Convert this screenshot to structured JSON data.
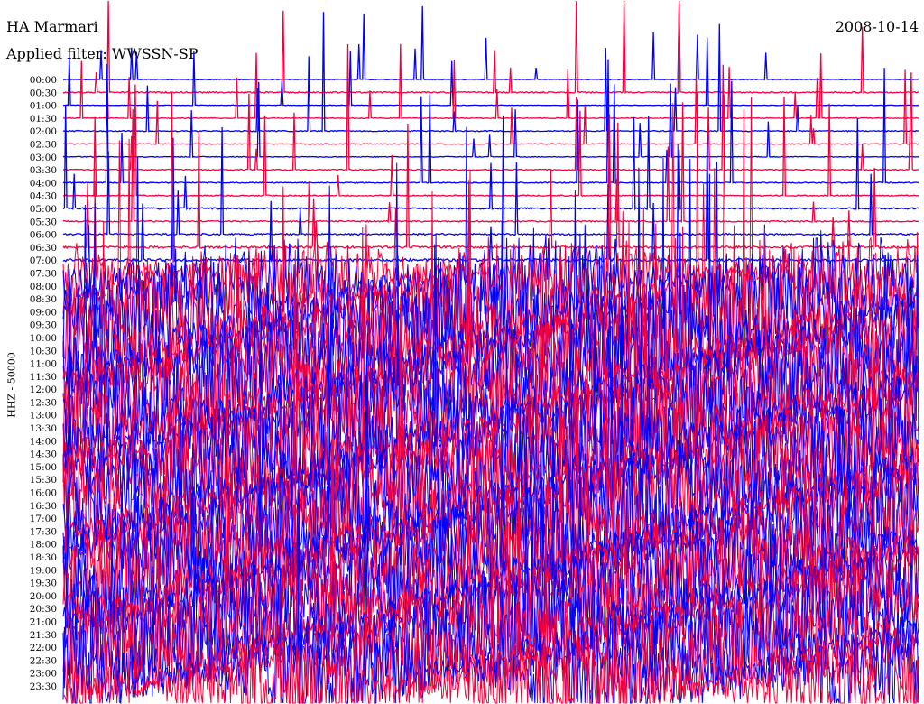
{
  "chart_data": {
    "type": "line",
    "title": "HA Marmari",
    "subtitle": "Applied filter: WWSSN-SP",
    "date": "2008-10-14",
    "ylabel": "HHZ - 50000",
    "xlabel": "",
    "grid": false,
    "colors": [
      "#0000ff",
      "#f5003c"
    ],
    "rows": [
      "00:00",
      "00:30",
      "01:00",
      "01:30",
      "02:00",
      "02:30",
      "03:00",
      "03:30",
      "04:00",
      "04:30",
      "05:00",
      "05:30",
      "06:00",
      "06:30",
      "07:00",
      "07:30",
      "08:00",
      "08:30",
      "09:00",
      "09:30",
      "10:00",
      "10:30",
      "11:00",
      "11:30",
      "12:00",
      "12:30",
      "13:00",
      "13:30",
      "14:00",
      "14:30",
      "15:00",
      "15:30",
      "16:00",
      "16:30",
      "17:00",
      "17:30",
      "18:00",
      "18:30",
      "19:00",
      "19:30",
      "20:00",
      "20:30",
      "21:00",
      "21:30",
      "22:00",
      "22:30",
      "23:00",
      "23:30"
    ],
    "relative_noise_level": [
      0.02,
      0.05,
      0.02,
      0.03,
      0.04,
      0.03,
      0.03,
      0.04,
      0.04,
      0.04,
      0.06,
      0.05,
      0.06,
      0.08,
      0.1,
      0.6,
      0.9,
      1,
      1,
      1,
      1,
      1,
      1,
      1,
      1,
      1,
      1,
      1,
      1,
      1,
      1,
      1,
      1,
      1,
      1,
      1,
      1,
      1,
      1,
      1,
      1,
      1,
      1,
      1,
      1,
      1,
      1,
      1
    ],
    "trace_end_fraction": [
      1,
      1,
      1,
      1,
      1,
      1,
      1,
      1,
      1,
      1,
      1,
      1,
      1,
      1,
      1,
      1,
      1,
      1,
      1,
      1,
      1,
      1,
      1,
      1,
      1,
      1,
      1,
      1,
      1,
      1,
      1,
      1,
      1,
      1,
      1,
      1,
      1,
      1,
      1,
      1,
      1,
      1,
      1,
      1,
      1,
      1,
      1,
      1
    ]
  }
}
